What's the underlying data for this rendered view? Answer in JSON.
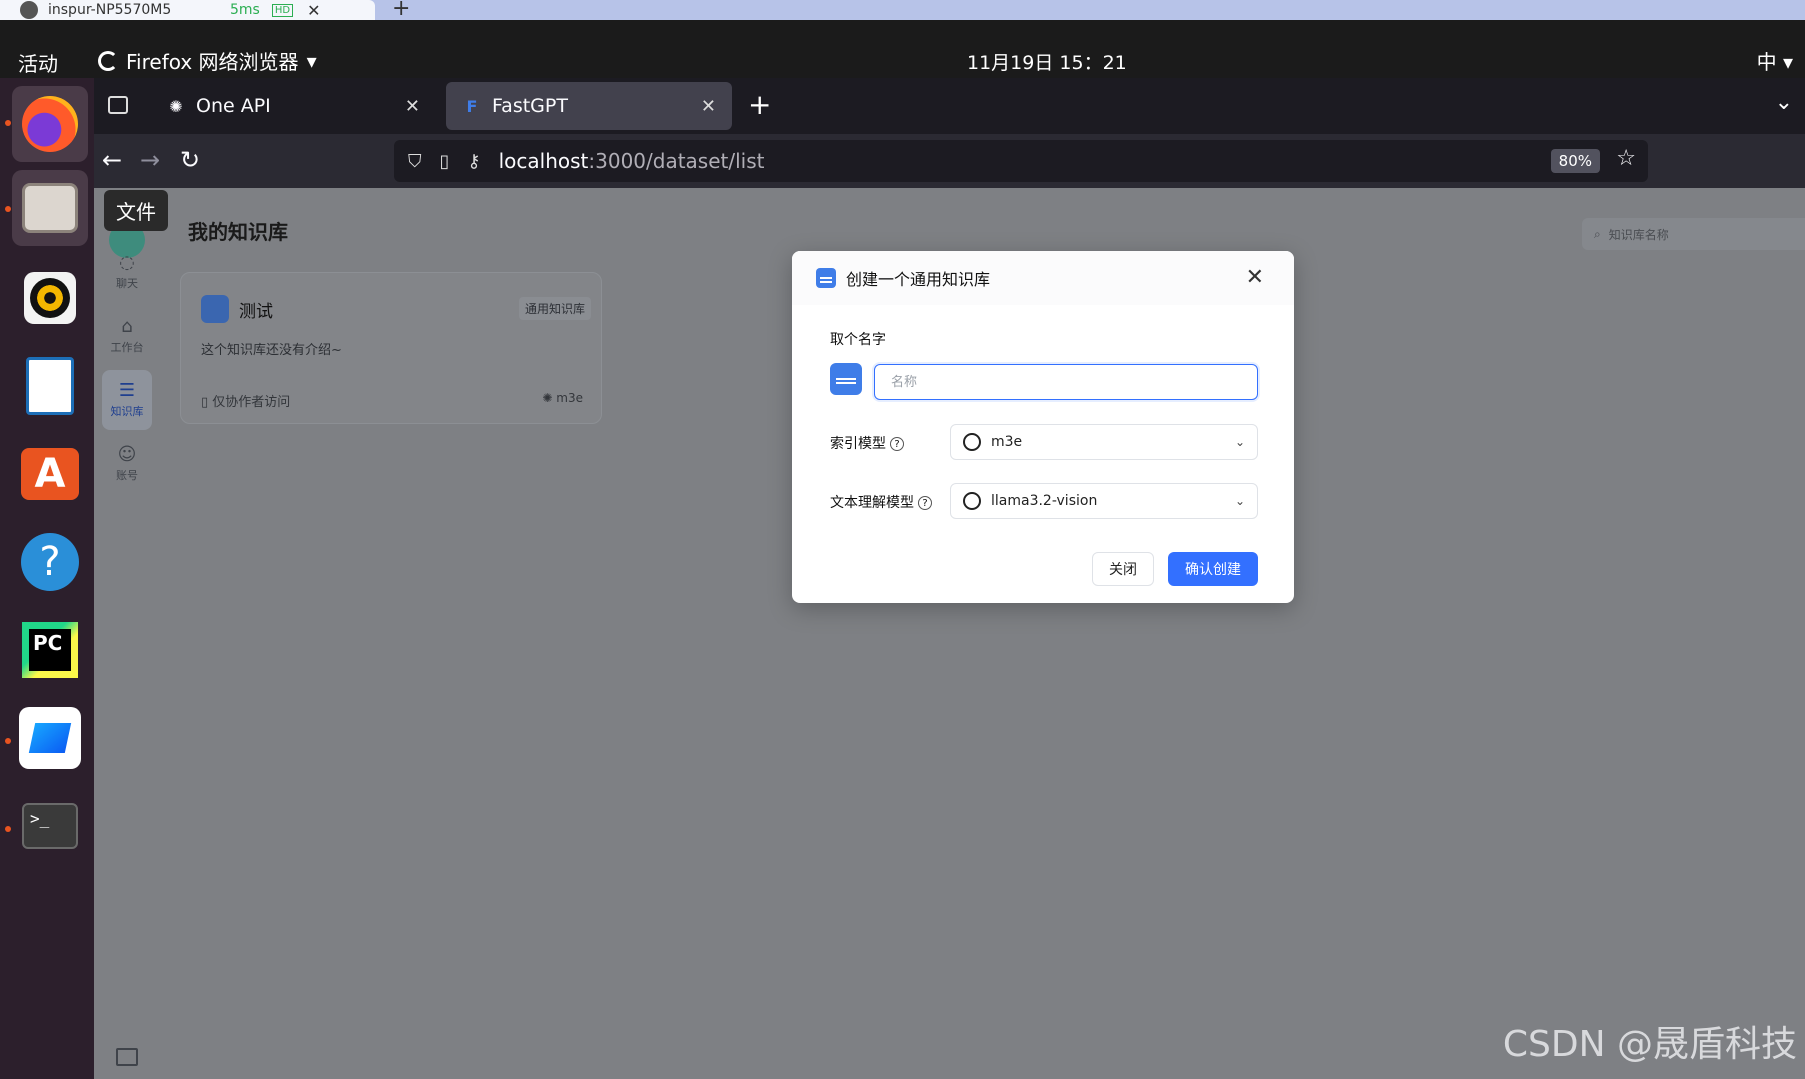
{
  "remote": {
    "host": "inspur-NP5570M5",
    "latency": "5ms",
    "hd": "HD"
  },
  "topbar": {
    "activities": "活动",
    "app_menu": "Firefox 网络浏览器",
    "clock": "11月19日 15：21",
    "ime": "中"
  },
  "dock": {
    "tooltip": "文件"
  },
  "browser": {
    "tabs": [
      {
        "title": "One API"
      },
      {
        "title": "FastGPT"
      }
    ],
    "url_host": "localhost",
    "url_path": ":3000/dataset/list",
    "zoom": "80%"
  },
  "page": {
    "title": "我的知识库",
    "search_placeholder": "知识库名称",
    "nav": [
      {
        "label": "聊天"
      },
      {
        "label": "工作台"
      },
      {
        "label": "知识库"
      },
      {
        "label": "账号"
      }
    ],
    "dataset_card": {
      "name": "测试",
      "type": "通用知识库",
      "intro": "这个知识库还没有介绍~",
      "permission": "仅协作者访问",
      "model": "m3e"
    }
  },
  "modal": {
    "title": "创建一个通用知识库",
    "name_label": "取个名字",
    "name_placeholder": "名称",
    "index_model_label": "索引模型",
    "index_model_value": "m3e",
    "text_model_label": "文本理解模型",
    "text_model_value": "llama3.2-vision",
    "cancel": "关闭",
    "confirm": "确认创建"
  },
  "watermark": "CSDN @晟盾科技"
}
